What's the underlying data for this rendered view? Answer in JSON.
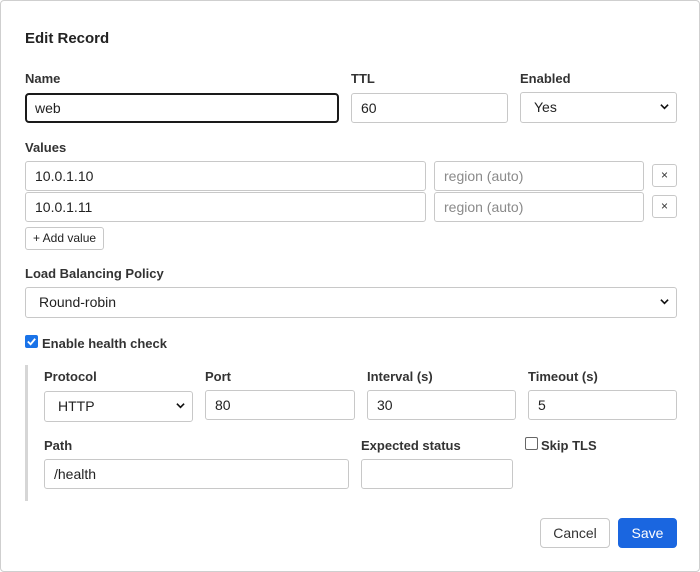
{
  "dialog": {
    "title": "Edit Record"
  },
  "fields": {
    "name": {
      "label": "Name",
      "value": "web"
    },
    "ttl": {
      "label": "TTL",
      "value": "60"
    },
    "enabled": {
      "label": "Enabled",
      "value": "Yes"
    }
  },
  "values": {
    "label": "Values",
    "rows": [
      {
        "value": "10.0.1.10",
        "region_placeholder": "region (auto)",
        "remove_label": "×"
      },
      {
        "value": "10.0.1.11",
        "region_placeholder": "region (auto)",
        "remove_label": "×"
      }
    ],
    "add_label": "+ Add value"
  },
  "load_balancing": {
    "label": "Load Balancing Policy",
    "value": "Round-robin"
  },
  "health_check": {
    "enable_label": "Enable health check",
    "enabled": true,
    "protocol": {
      "label": "Protocol",
      "value": "HTTP"
    },
    "port": {
      "label": "Port",
      "value": "80"
    },
    "interval": {
      "label": "Interval (s)",
      "value": "30"
    },
    "timeout": {
      "label": "Timeout (s)",
      "value": "5"
    },
    "path": {
      "label": "Path",
      "value": "/health"
    },
    "expected_status": {
      "label": "Expected status",
      "value": ""
    },
    "skip_tls": {
      "label": "Skip TLS",
      "checked": false
    }
  },
  "actions": {
    "cancel_label": "Cancel",
    "save_label": "Save"
  },
  "colors": {
    "accent": "#1a66e0",
    "checkbox": "#1a73e8",
    "border": "#c8c8c8"
  },
  "icons": {
    "select": "chevron-down-icon",
    "checkbox_checked": "check-icon",
    "remove": "close-icon"
  }
}
